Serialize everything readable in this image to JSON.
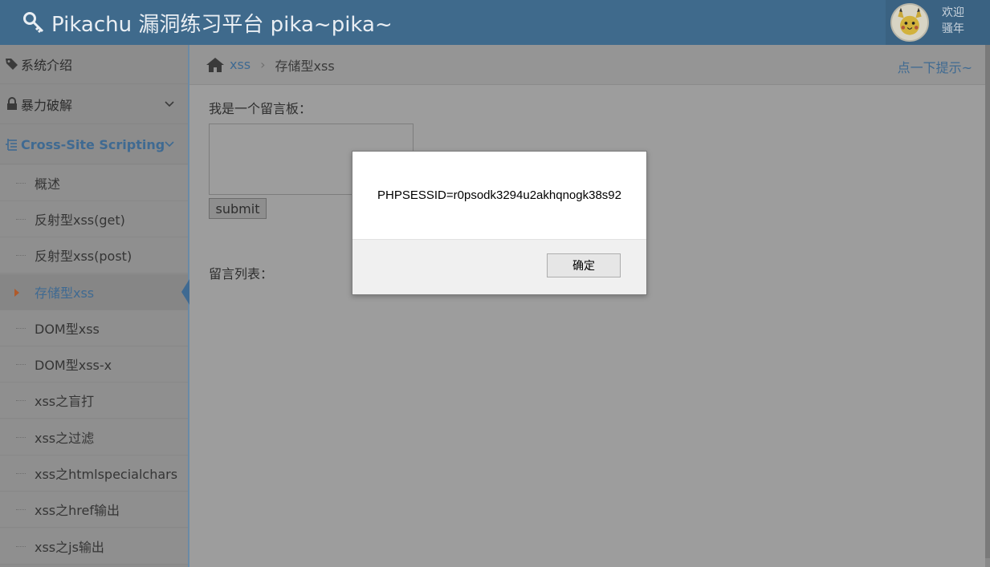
{
  "header": {
    "title": "Pikachu 漏洞练习平台 pika~pika~",
    "welcome_line1": "欢迎",
    "welcome_line2": "骚年"
  },
  "sidebar": {
    "items": [
      {
        "label": "系统介绍",
        "icon": "tag-icon"
      },
      {
        "label": "暴力破解",
        "icon": "lock-icon"
      },
      {
        "label": "Cross-Site Scripting",
        "icon": "tree-icon"
      }
    ],
    "sub_items": [
      {
        "label": "概述"
      },
      {
        "label": "反射型xss(get)"
      },
      {
        "label": "反射型xss(post)"
      },
      {
        "label": "存储型xss"
      },
      {
        "label": "DOM型xss"
      },
      {
        "label": "DOM型xss-x"
      },
      {
        "label": "xss之盲打"
      },
      {
        "label": "xss之过滤"
      },
      {
        "label": "xss之htmlspecialchars"
      },
      {
        "label": "xss之href输出"
      },
      {
        "label": "xss之js输出"
      }
    ]
  },
  "breadcrumb": {
    "link": "xss",
    "separator": "›",
    "current": "存储型xss"
  },
  "main": {
    "hint": "点一下提示~",
    "board_label": "我是一个留言板：",
    "textarea_value": "",
    "submit_label": "submit",
    "list_label": "留言列表："
  },
  "dialog": {
    "message": "PHPSESSID=r0psodk3294u2akhqnogk38s92",
    "ok_label": "确定"
  },
  "colors": {
    "header_bg": "#3f6a8c",
    "accent": "#3f6a92",
    "overlay": "#9a9a9a"
  }
}
